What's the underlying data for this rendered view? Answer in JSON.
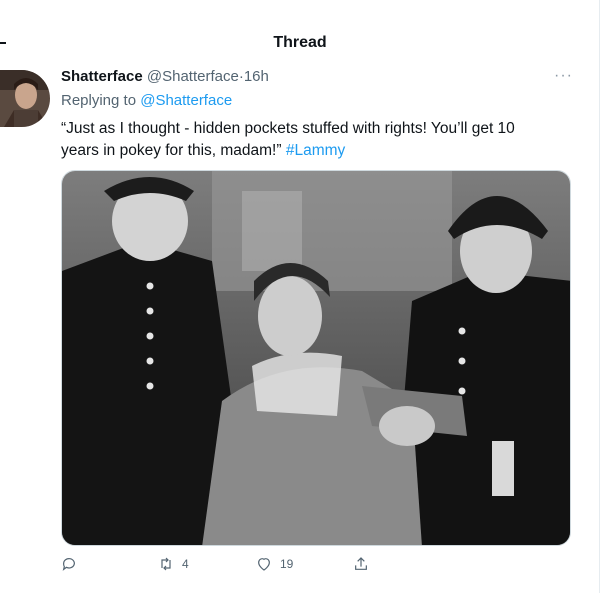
{
  "header": {
    "title": "Thread"
  },
  "tweet": {
    "author_name": "Shatterface",
    "author_handle": "@Shatterface",
    "separator": "·",
    "time": "16h",
    "replying_prefix": "Replying to",
    "replying_to": "@Shatterface",
    "text": "“Just as I thought - hidden pockets stuffed with rights! You’ll get 10 years in pokey for this, madam!”",
    "hashtag": "#Lammy",
    "more_label": "···"
  },
  "actions": {
    "reply_count": "",
    "retweet_count": "4",
    "like_count": "19",
    "share_count": ""
  },
  "colors": {
    "link": "#1d9bf0",
    "muted": "#536471",
    "text": "#0f1419"
  },
  "icons": [
    "reply-icon",
    "retweet-icon",
    "like-icon",
    "share-icon",
    "more-icon"
  ]
}
